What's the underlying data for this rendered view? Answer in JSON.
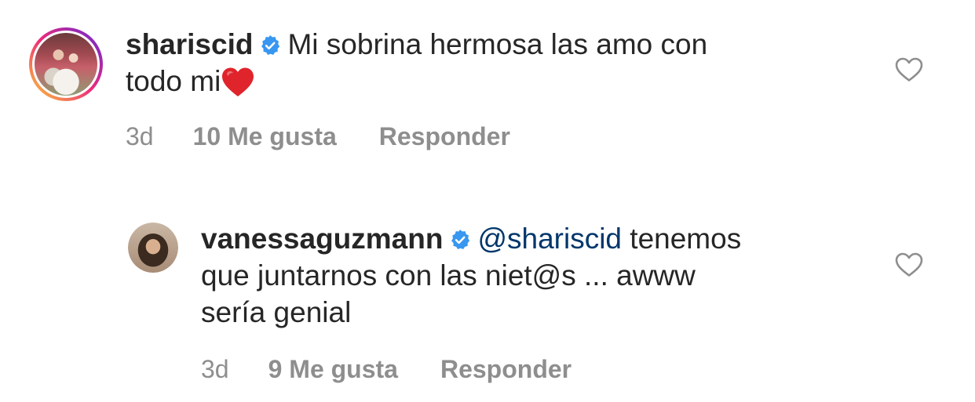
{
  "comments": [
    {
      "username": "shariscid",
      "text_line1": "Mi sobrina hermosa las amo con",
      "text_line2": "todo mi",
      "emoji": "heart-emoji",
      "time": "3d",
      "likes": "10 Me gusta",
      "reply_label": "Responder"
    },
    {
      "username": "vanessaguzmann",
      "mention": "@shariscid",
      "text_line1_rest": "tenemos",
      "text_line2": "que juntarnos con las niet@s ... awww",
      "text_line3": "sería genial",
      "time": "3d",
      "likes": "9 Me gusta",
      "reply_label": "Responder"
    }
  ],
  "colors": {
    "text": "#262626",
    "meta": "#8e8e8e",
    "mention": "#00376b",
    "verified": "#3897f0",
    "heart_emoji": "#e0242b"
  },
  "icons": {
    "verified": "verified-badge-icon",
    "like": "heart-outline-icon"
  }
}
